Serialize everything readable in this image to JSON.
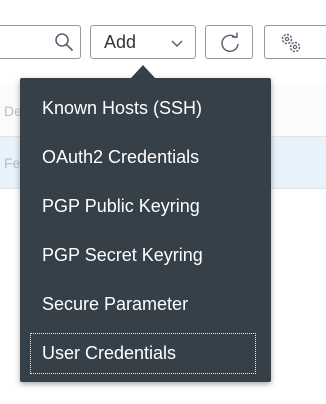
{
  "table": {
    "header_fragment": "Dep",
    "row_fragment": "Fe"
  },
  "toolbar": {
    "search_icon": "search-icon",
    "add_label": "Add",
    "add_chevron_icon": "chevron-down-icon",
    "refresh_icon": "refresh-icon",
    "settings_icon": "settings-icon"
  },
  "menu": {
    "items": [
      {
        "label": "Known Hosts (SSH)"
      },
      {
        "label": "OAuth2 Credentials"
      },
      {
        "label": "PGP Public Keyring"
      },
      {
        "label": "PGP Secret Keyring"
      },
      {
        "label": "Secure Parameter"
      },
      {
        "label": "User Credentials",
        "focused": true
      }
    ]
  },
  "colors": {
    "menu_background": "#354049",
    "menu_text": "#ffffff",
    "button_border": "#8f9aa4",
    "selected_row": "#e8f2fb"
  }
}
